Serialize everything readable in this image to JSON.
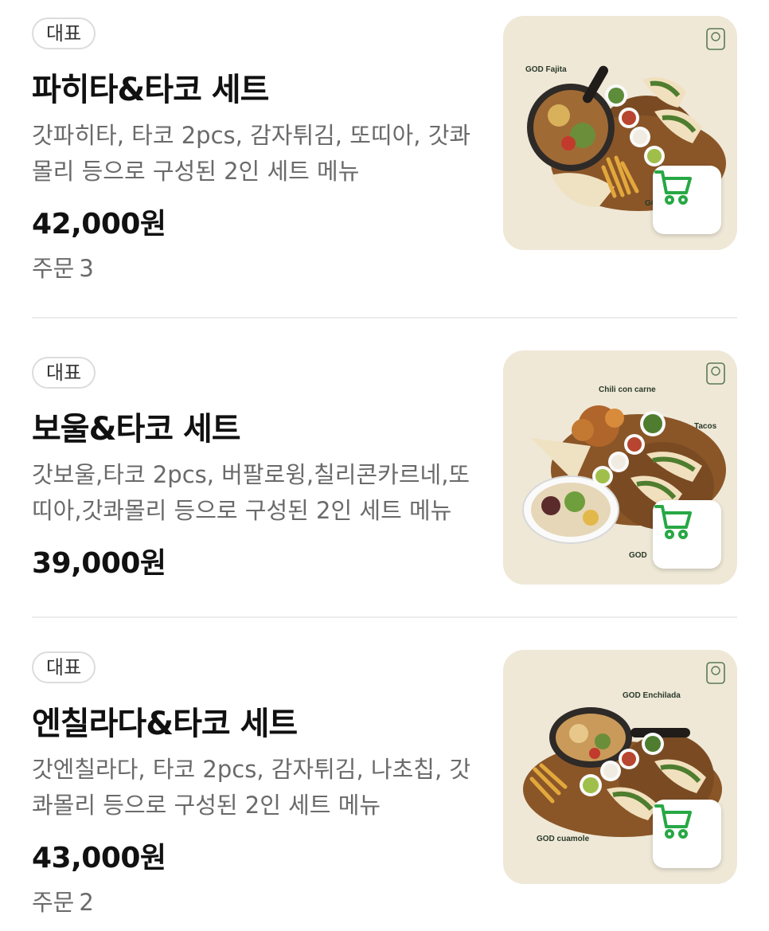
{
  "theme": {
    "accent": "#27a844",
    "thumb_bg": "#efe8d7",
    "text_secondary": "#6a6a6a",
    "divider": "#ececec"
  },
  "menu_items": [
    {
      "badge": "대표",
      "name": "파히타&타코 세트",
      "description": "갓파히타, 타코 2pcs, 감자튀김, 또띠아, 갓콰몰리 등으로 구성된 2인 세트 메뉴",
      "price": "42,000원",
      "orders_label": "주문",
      "orders_count": "3",
      "image_labels": [
        "GOD Fajita",
        "GO"
      ],
      "cart_icon": "cart-icon"
    },
    {
      "badge": "대표",
      "name": "보울&타코 세트",
      "description": "갓보울,타코 2pcs, 버팔로윙,칠리콘카르네,또띠아,갓콰몰리 등으로 구성된 2인 세트 메뉴",
      "price": "39,000원",
      "image_labels": [
        "Chili con carne",
        "Tacos",
        "GOD"
      ],
      "cart_icon": "cart-icon"
    },
    {
      "badge": "대표",
      "name": "엔칠라다&타코 세트",
      "description": "갓엔칠라다, 타코 2pcs, 감자튀김, 나초칩, 갓콰몰리 등으로 구성된 2인 세트 메뉴",
      "price": "43,000원",
      "orders_label": "주문",
      "orders_count": "2",
      "image_labels": [
        "GOD Enchilada",
        "GOD cuamole"
      ],
      "cart_icon": "cart-icon"
    }
  ]
}
